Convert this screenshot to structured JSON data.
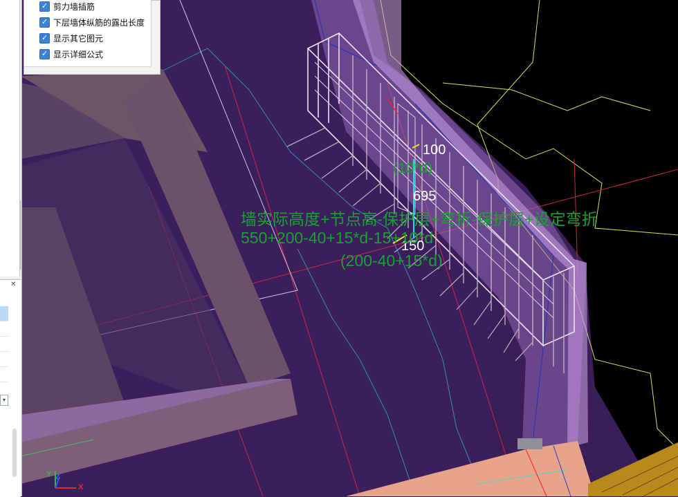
{
  "options": [
    {
      "label": "剪力墙插筋",
      "checked": true
    },
    {
      "label": "下层墙体纵筋的露出长度",
      "checked": true
    },
    {
      "label": "显示其它图元",
      "checked": true
    },
    {
      "label": "显示详细公式",
      "checked": true
    }
  ],
  "dimensions": {
    "dim_top": "100",
    "dim_top_formula": "(10*d)",
    "dim_middle": "695",
    "dim_bottom": "150"
  },
  "formula": {
    "description": "墙实际高度+节点高-保护层+弯折-保护层+设定弯折",
    "expression": "550+200-40+15*d-15+10*d",
    "sub_expression": "(200-40+15*d)"
  },
  "axis": {
    "x": "X",
    "y": "Y",
    "z": "Z"
  },
  "panel": {
    "close_glyph": "✕",
    "combo_glyph": "▾"
  },
  "colors": {
    "background": "#3a1f58",
    "formula_green": "#16a32e",
    "checkbox_blue": "#3a82d6",
    "wall_violet": "#b98ad8",
    "beam_brown": "#6e5566",
    "slab_salmon": "#e8a58c"
  }
}
